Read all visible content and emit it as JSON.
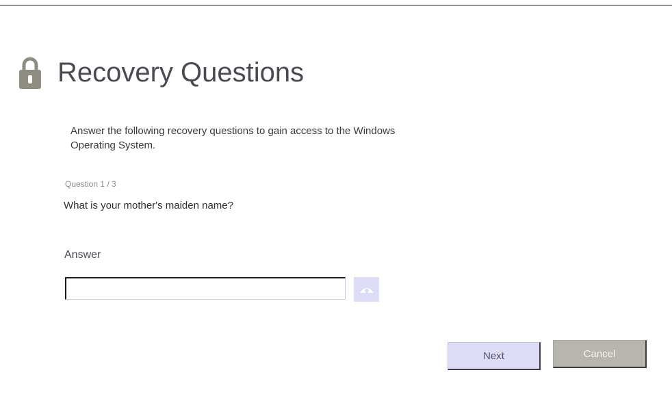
{
  "header": {
    "title": "Recovery Questions",
    "icon": "lock-icon",
    "icon_color": "#8f8c82"
  },
  "instructions": "Answer the following recovery questions to gain access to the Windows Operating System.",
  "question": {
    "counter": "Question 1 / 3",
    "text": "What is your mother's maiden name?"
  },
  "answer": {
    "label": "Answer",
    "value": "",
    "placeholder": "",
    "reveal_icon": "eye-icon"
  },
  "buttons": {
    "next_label": "Next",
    "cancel_label": "Cancel"
  },
  "colors": {
    "next_bg": "#dcdcf7",
    "cancel_bg": "#b7b5ac",
    "reveal_bg": "#dcdcf6"
  }
}
